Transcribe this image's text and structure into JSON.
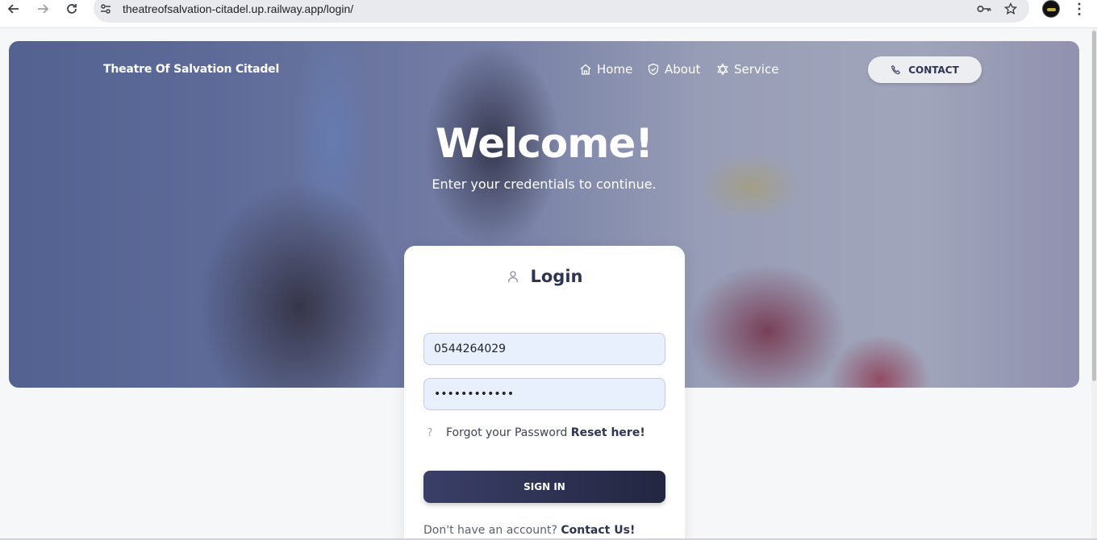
{
  "browser": {
    "url": "theatreofsalvation-citadel.up.railway.app/login/"
  },
  "header": {
    "brand": "Theatre Of Salvation Citadel",
    "nav": [
      {
        "label": "Home",
        "icon": "home-icon"
      },
      {
        "label": "About",
        "icon": "shield-icon"
      },
      {
        "label": "Service",
        "icon": "star-of-david-icon"
      }
    ],
    "contact_label": "CONTACT"
  },
  "hero": {
    "title": "Welcome!",
    "subtitle": "Enter your credentials to continue."
  },
  "login": {
    "title": "Login",
    "username_value": "0544264029",
    "password_value": "••••••••••••",
    "forgot_text": "Forgot your Password",
    "reset_link": "Reset here!",
    "signin_label": "SIGN IN",
    "noacct_text": "Don't have an account?",
    "contact_link": "Contact Us!"
  },
  "colors": {
    "accent": "#2e3553",
    "input_bg": "#e8f0fe"
  }
}
